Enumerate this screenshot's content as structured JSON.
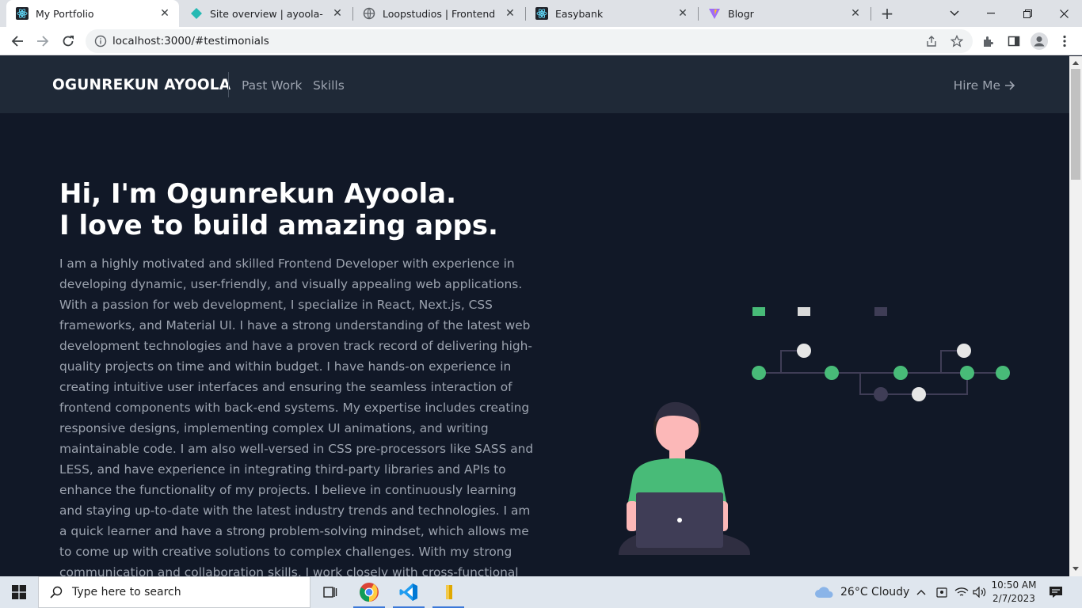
{
  "browser": {
    "tabs": [
      {
        "title": "My Portfolio",
        "active": true,
        "icon": "react-icon"
      },
      {
        "title": "Site overview | ayoola-ogun-",
        "active": false,
        "icon": "netlify-icon"
      },
      {
        "title": "Loopstudios | Frontend ment",
        "active": false,
        "icon": "globe-icon"
      },
      {
        "title": "Easybank",
        "active": false,
        "icon": "react-icon"
      },
      {
        "title": "Blogr",
        "active": false,
        "icon": "vite-icon"
      }
    ],
    "new_tab_label": "+",
    "url": "localhost:3000/#testimonials"
  },
  "site": {
    "brand": "OGUNREKUN AYOOLA",
    "nav": [
      "Past Work",
      "Skills"
    ],
    "hire_label": "Hire Me",
    "hero_line1": "Hi, I'm Ogunrekun Ayoola.",
    "hero_line2": "I love to build amazing apps.",
    "bio": "I am a highly motivated and skilled Frontend Developer with experience in developing dynamic, user-friendly, and visually appealing web applications. With a passion for web development, I specialize in React, Next.js, CSS frameworks, and Material UI. I have a strong understanding of the latest web development technologies and have a proven track record of delivering high-quality projects on time and within budget. I have hands-on experience in creating intuitive user interfaces and ensuring the seamless interaction of frontend components with back-end systems. My expertise includes creating responsive designs, implementing complex UI animations, and writing maintainable code. I am also well-versed in CSS pre-processors like SASS and LESS, and have experience in integrating third-party libraries and APIs to enhance the functionality of my projects. I believe in continuously learning and staying up-to-date with the latest industry trends and technologies. I am a quick learner and have a strong problem-solving mindset, which allows me to come up with creative solutions to complex challenges. With my strong communication and collaboration skills, I work closely with cross-functional teams to ensure the successful delivery of projects. I am committed to delivering",
    "colors": {
      "nav_bg": "#1f2937",
      "page_bg": "#111827",
      "accent_green": "#48bb78",
      "text_muted": "#9ca3af"
    }
  },
  "taskbar": {
    "search_placeholder": "Type here to search",
    "apps": [
      "task-view-icon",
      "chrome-icon",
      "vscode-icon",
      "file-explorer-icon"
    ],
    "weather": "26°C  Cloudy",
    "time": "10:50 AM",
    "date": "2/7/2023"
  }
}
